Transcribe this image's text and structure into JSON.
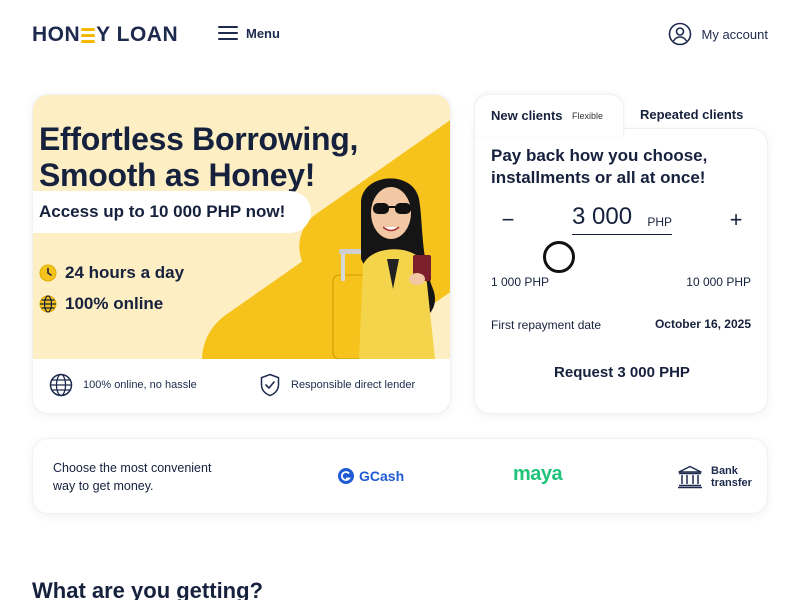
{
  "header": {
    "logo_left": "HON",
    "logo_right": "Y LOAN",
    "menu_label": "Menu",
    "account_label": "My account"
  },
  "promo": {
    "title_line1": "Effortless Borrowing,",
    "title_line2": "Smooth as Honey!",
    "subtitle": "Access up to 10 000 PHP now!",
    "feature_1": "24 hours a day",
    "feature_2": "100% online",
    "footer_1": "100% online, no hassle",
    "footer_2": "Responsible direct lender"
  },
  "calculator": {
    "tab_new": "New clients",
    "tab_new_badge": "Flexible",
    "tab_repeat": "Repeated clients",
    "heading": "Pay back how you choose, installments or all at once!",
    "decrement": "−",
    "increment": "+",
    "amount": "3 000",
    "currency": "PHP",
    "range_min": "1 000 PHP",
    "range_max": "10 000 PHP",
    "repayment_label": "First repayment date",
    "repayment_date": "October 16, 2025",
    "request_label": "Request 3 000 PHP"
  },
  "methods": {
    "text": "Choose the most convenient way to get money.",
    "gcash": "GCash",
    "maya": "maya",
    "bank_line1": "Bank",
    "bank_line2": "transfer"
  },
  "section": {
    "title": "What are you getting?"
  },
  "colors": {
    "brand_navy": "#1d2a4d",
    "honey_yellow": "#f6c31c",
    "banner_bg": "#fdefc3",
    "gcash_blue": "#1f5bd6",
    "maya_green": "#1fc47a"
  }
}
